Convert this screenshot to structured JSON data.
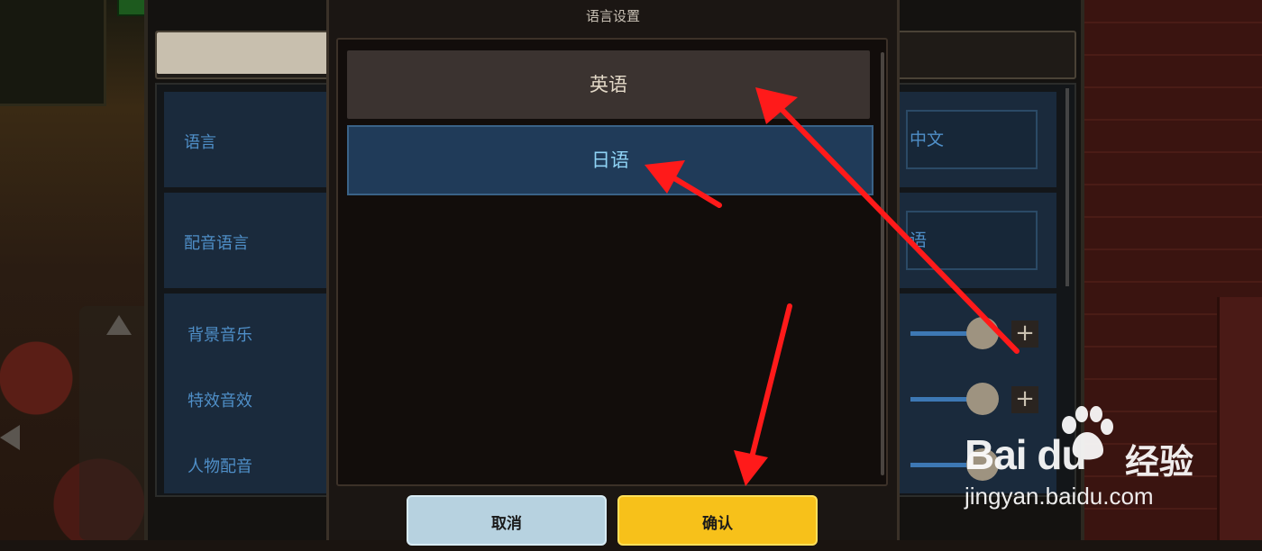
{
  "modal": {
    "title": "语言设置",
    "options": [
      {
        "label": "英语",
        "state": "hover"
      },
      {
        "label": "日语",
        "state": "selected"
      }
    ],
    "cancel_label": "取消",
    "confirm_label": "确认"
  },
  "settings": {
    "rows": [
      {
        "label": "语言",
        "value": "中文"
      },
      {
        "label": "配音语言",
        "value": "语"
      }
    ],
    "audio": [
      {
        "label": "背景音乐"
      },
      {
        "label": "特效音效"
      },
      {
        "label": "人物配音"
      }
    ],
    "plus_glyph": "+"
  },
  "watermark": {
    "brand": "Bai du",
    "cn": "经验",
    "url": "jingyan.baidu.com"
  },
  "colors": {
    "selected_option": "#203b59",
    "confirm_button": "#f7c11a",
    "cancel_button": "#b7d2e0",
    "annotation_arrow": "#ff1a1a"
  }
}
